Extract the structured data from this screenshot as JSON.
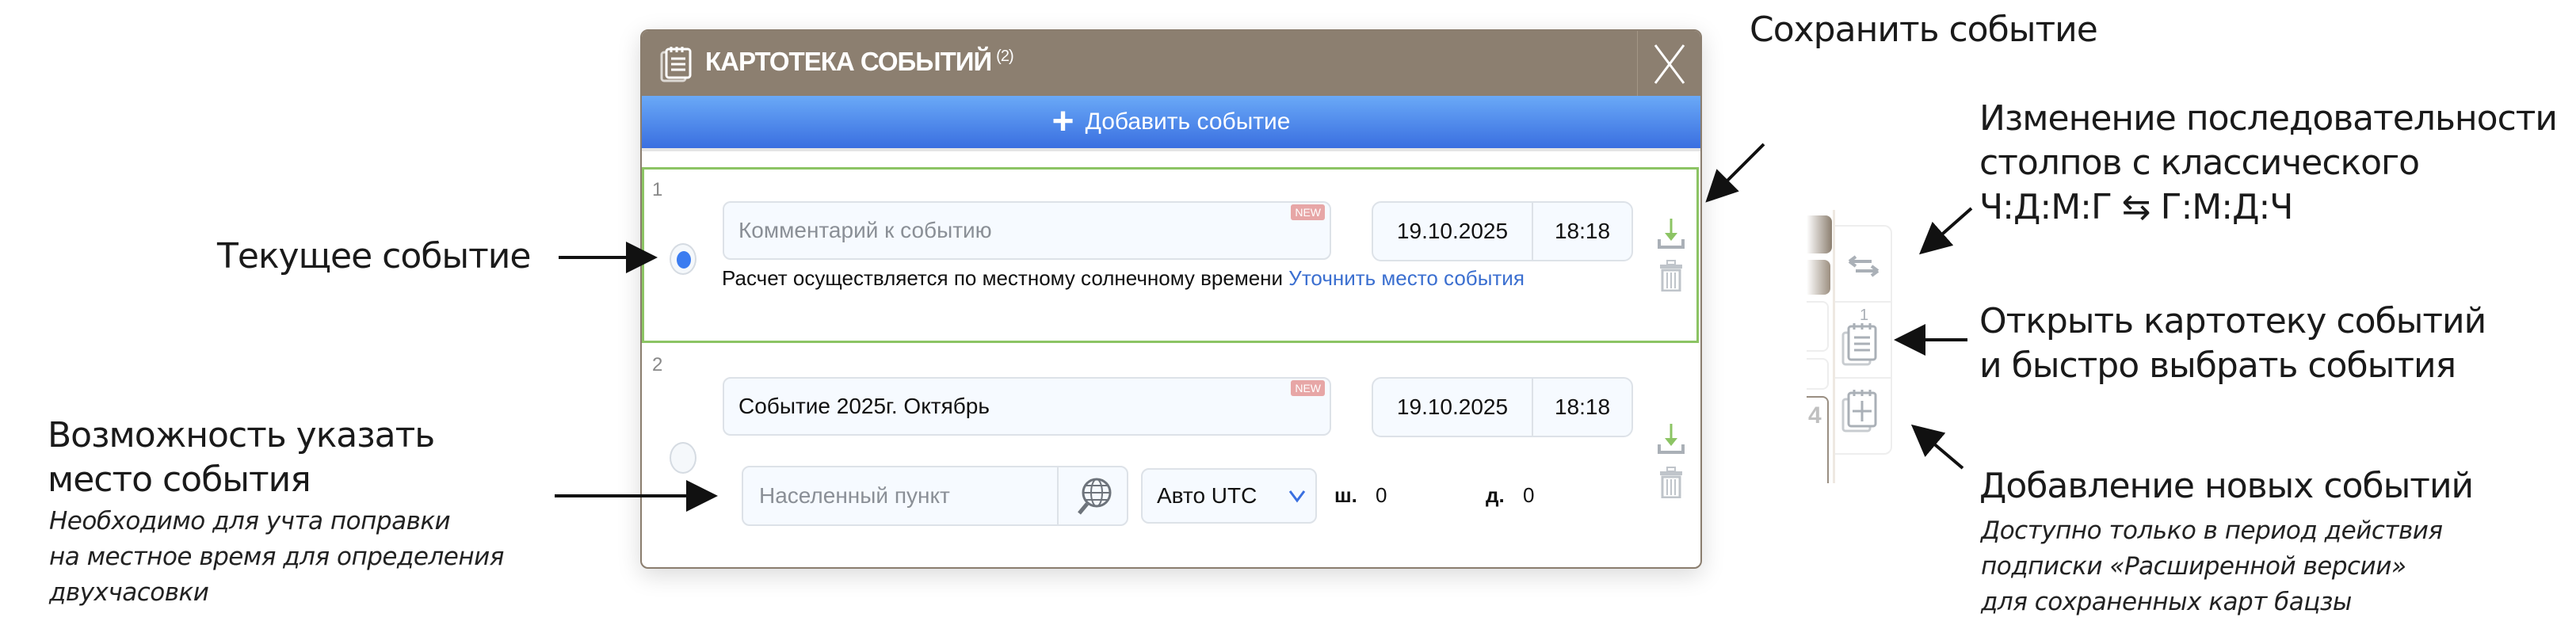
{
  "modal": {
    "title": "КАРТОТЕКА СОБЫТИЙ",
    "count": "(2)",
    "add_button": "Добавить событие",
    "events": [
      {
        "number": "1",
        "comment_placeholder": "Комментарий к событию",
        "comment_value": "",
        "badge": "NEW",
        "date": "19.10.2025",
        "time": "18:18",
        "selected": true,
        "info_text": "Расчет осуществляется по местному солнечному времени",
        "info_link": "Уточнить место события"
      },
      {
        "number": "2",
        "comment_value": "Событие 2025г. Октябрь",
        "badge": "NEW",
        "date": "19.10.2025",
        "time": "18:18",
        "selected": false,
        "location_placeholder": "Населенный пункт",
        "timezone": "Авто UTC",
        "lat_label": "ш.",
        "lat_value": "0",
        "lon_label": "д.",
        "lon_value": "0"
      }
    ]
  },
  "side_panel": {
    "tab_number": "4",
    "calendar_badge": "1"
  },
  "annotations": {
    "save": "Сохранить событие",
    "order_lines": [
      "Изменение последовательности",
      "столпов с классического",
      "Ч:Д:М:Г ⇆ Г:М:Д:Ч"
    ],
    "open_lines": [
      "Открыть картотеку событий",
      "и быстро выбрать события"
    ],
    "add_title": "Добавление новых событий",
    "add_note": [
      "Доступно только в период действия",
      "подписки «Расширенной версии»",
      "для сохраненных карт бацзы"
    ],
    "current": "Текущее событие",
    "place_lines": [
      "Возможность указать",
      "место события"
    ],
    "place_note": [
      "Необходимо для учта поправки",
      "на местное время для определения",
      "двухчасовки"
    ]
  },
  "colors": {
    "titlebar": "#8c7f70",
    "accent_blue": "#3a6fe0",
    "selected_border": "#8cc464",
    "link": "#3b6fd0",
    "badge": "#e7a6a6"
  }
}
